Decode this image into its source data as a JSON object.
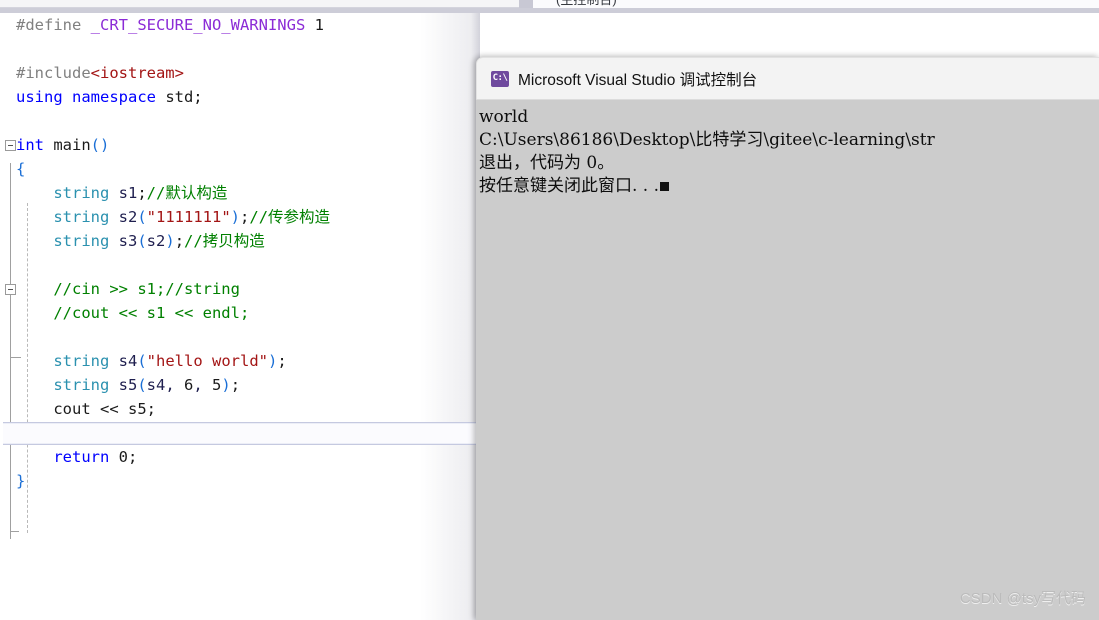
{
  "top_strip": {
    "clipped_text": "(主控制台)"
  },
  "editor": {
    "name": "visual-studio-code-editor",
    "lines": [
      {
        "id": "l1",
        "tokens": [
          {
            "c": "t-pp",
            "t": "#define "
          },
          {
            "c": "t-macro",
            "t": "_CRT_SECURE_NO_WARNINGS"
          },
          {
            "c": "t-num",
            "t": " 1"
          }
        ]
      },
      {
        "id": "l2",
        "tokens": []
      },
      {
        "id": "l3",
        "tokens": [
          {
            "c": "t-pp",
            "t": "#include"
          },
          {
            "c": "t-hdr",
            "t": "<iostream>"
          }
        ]
      },
      {
        "id": "l4",
        "tokens": [
          {
            "c": "t-kw",
            "t": "using namespace "
          },
          {
            "c": "t-plain",
            "t": "std;"
          }
        ]
      },
      {
        "id": "l5",
        "tokens": []
      },
      {
        "id": "l6",
        "tokens": [
          {
            "c": "t-kw",
            "t": "int "
          },
          {
            "c": "t-plain",
            "t": "main"
          },
          {
            "c": "t-brace",
            "t": "()"
          }
        ]
      },
      {
        "id": "l7",
        "tokens": [
          {
            "c": "t-brace",
            "t": "{"
          }
        ]
      },
      {
        "id": "l8",
        "tokens": [
          {
            "c": "t-plain",
            "t": "    "
          },
          {
            "c": "t-type",
            "t": "string"
          },
          {
            "c": "t-id",
            "t": " s1"
          },
          {
            "c": "t-punct",
            "t": ";"
          },
          {
            "c": "t-cmt",
            "t": "//默认构造"
          }
        ]
      },
      {
        "id": "l9",
        "tokens": [
          {
            "c": "t-plain",
            "t": "    "
          },
          {
            "c": "t-type",
            "t": "string"
          },
          {
            "c": "t-id",
            "t": " s2"
          },
          {
            "c": "t-brace",
            "t": "("
          },
          {
            "c": "t-str",
            "t": "\"1111111\""
          },
          {
            "c": "t-brace",
            "t": ")"
          },
          {
            "c": "t-punct",
            "t": ";"
          },
          {
            "c": "t-cmt",
            "t": "//传参构造"
          }
        ]
      },
      {
        "id": "l10",
        "tokens": [
          {
            "c": "t-plain",
            "t": "    "
          },
          {
            "c": "t-type",
            "t": "string"
          },
          {
            "c": "t-id",
            "t": " s3"
          },
          {
            "c": "t-brace",
            "t": "("
          },
          {
            "c": "t-id",
            "t": "s2"
          },
          {
            "c": "t-brace",
            "t": ")"
          },
          {
            "c": "t-punct",
            "t": ";"
          },
          {
            "c": "t-cmt",
            "t": "//拷贝构造"
          }
        ]
      },
      {
        "id": "l11",
        "tokens": []
      },
      {
        "id": "l12",
        "tokens": [
          {
            "c": "t-plain",
            "t": "    "
          },
          {
            "c": "t-cmt",
            "t": "//cin >> s1;//string"
          }
        ]
      },
      {
        "id": "l13",
        "tokens": [
          {
            "c": "t-plain",
            "t": "    "
          },
          {
            "c": "t-cmt",
            "t": "//cout << s1 << endl;"
          }
        ]
      },
      {
        "id": "l14",
        "tokens": []
      },
      {
        "id": "l15",
        "tokens": [
          {
            "c": "t-plain",
            "t": "    "
          },
          {
            "c": "t-type",
            "t": "string"
          },
          {
            "c": "t-id",
            "t": " s4"
          },
          {
            "c": "t-brace",
            "t": "("
          },
          {
            "c": "t-str",
            "t": "\"hello world\""
          },
          {
            "c": "t-brace",
            "t": ")"
          },
          {
            "c": "t-punct",
            "t": ";"
          }
        ]
      },
      {
        "id": "l16",
        "tokens": [
          {
            "c": "t-plain",
            "t": "    "
          },
          {
            "c": "t-type",
            "t": "string"
          },
          {
            "c": "t-id",
            "t": " s5"
          },
          {
            "c": "t-brace",
            "t": "("
          },
          {
            "c": "t-id",
            "t": "s4, "
          },
          {
            "c": "t-num",
            "t": "6"
          },
          {
            "c": "t-id",
            "t": ", "
          },
          {
            "c": "t-num",
            "t": "5"
          },
          {
            "c": "t-brace",
            "t": ")"
          },
          {
            "c": "t-punct",
            "t": ";"
          }
        ]
      },
      {
        "id": "l17",
        "tokens": [
          {
            "c": "t-plain",
            "t": "    cout "
          },
          {
            "c": "t-plain",
            "t": "<< s5;"
          }
        ]
      },
      {
        "id": "l18",
        "tokens": []
      },
      {
        "id": "l19",
        "tokens": [
          {
            "c": "t-plain",
            "t": "    "
          },
          {
            "c": "t-kw",
            "t": "return "
          },
          {
            "c": "t-num",
            "t": "0"
          },
          {
            "c": "t-punct",
            "t": ";"
          }
        ]
      },
      {
        "id": "l20",
        "tokens": [
          {
            "c": "t-brace",
            "t": "}"
          }
        ]
      }
    ],
    "current_line_index": 18,
    "fold_markers": [
      {
        "name": "fold-marker-main",
        "line": 6
      },
      {
        "name": "fold-marker-block",
        "line": 12
      }
    ]
  },
  "console": {
    "name": "visual-studio-debug-console",
    "icon": "command-prompt-icon",
    "icon_glyph": "C:\\",
    "title": "Microsoft Visual Studio 调试控制台",
    "lines": [
      "world",
      "C:\\Users\\86186\\Desktop\\比特学习\\gitee\\c-learning\\str",
      "退出，代码为 0。",
      "按任意键关闭此窗口. . ."
    ],
    "cursor_visible": true
  },
  "watermark": {
    "text": "CSDN @tsy写代码"
  },
  "colors": {
    "editor_background": "#ffffff",
    "console_background": "#cccccc",
    "console_titlebar": "#f3f3f3",
    "console_icon": "#6f4a9e",
    "keyword": "#0000ff",
    "type": "#2b91af",
    "string": "#a31515",
    "comment": "#008000",
    "macro": "#8b2bd6",
    "preprocessor": "#808080",
    "brace": "#1b6fd6",
    "watermark": "#bcbcbc"
  }
}
